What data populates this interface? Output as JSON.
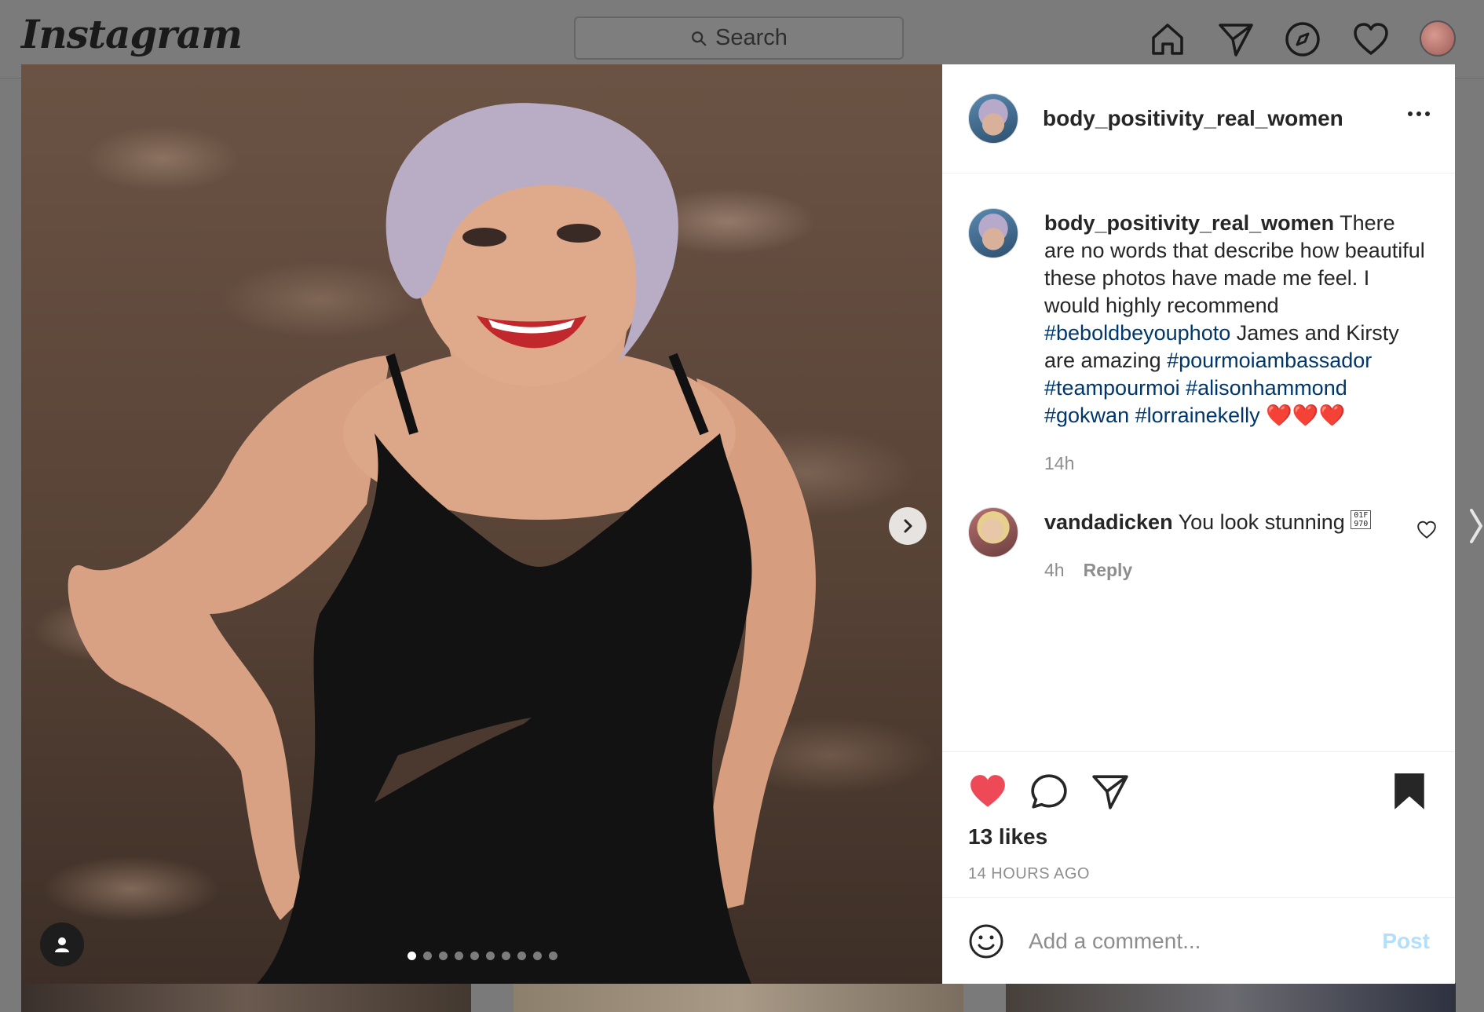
{
  "topbar": {
    "logo": "Instagram",
    "search_placeholder": "Search"
  },
  "post": {
    "username": "body_positivity_real_women",
    "caption": {
      "username": "body_positivity_real_women",
      "text_1": " There are no words that describe how beautiful these photos have made me feel. I would highly recommend ",
      "tag_1": "#beboldbeyouphoto",
      "text_2": " James and Kirsty are amazing ",
      "tag_2": "#pourmoiambassador",
      "tag_3": "#teampourmoi",
      "tag_4": "#alisonhammond",
      "tag_5": "#gokwan",
      "tag_6": "#lorrainekelly",
      "emojis": "❤️❤️❤️",
      "time": "14h"
    },
    "comments": [
      {
        "username": "vandadicken",
        "text": " You look stunning ",
        "emoji_placeholder": "01F 970",
        "time": "4h",
        "reply_label": "Reply"
      }
    ],
    "likes": "13 likes",
    "time_ago": "14 HOURS AGO",
    "carousel": {
      "count": 10,
      "active_index": 0
    },
    "add_comment": {
      "placeholder": "Add a comment...",
      "post_label": "Post"
    },
    "liked": true,
    "saved": true
  },
  "colors": {
    "like_red": "#ed4956",
    "hashtag": "#00376b",
    "post_button_disabled": "#b2dffc"
  }
}
